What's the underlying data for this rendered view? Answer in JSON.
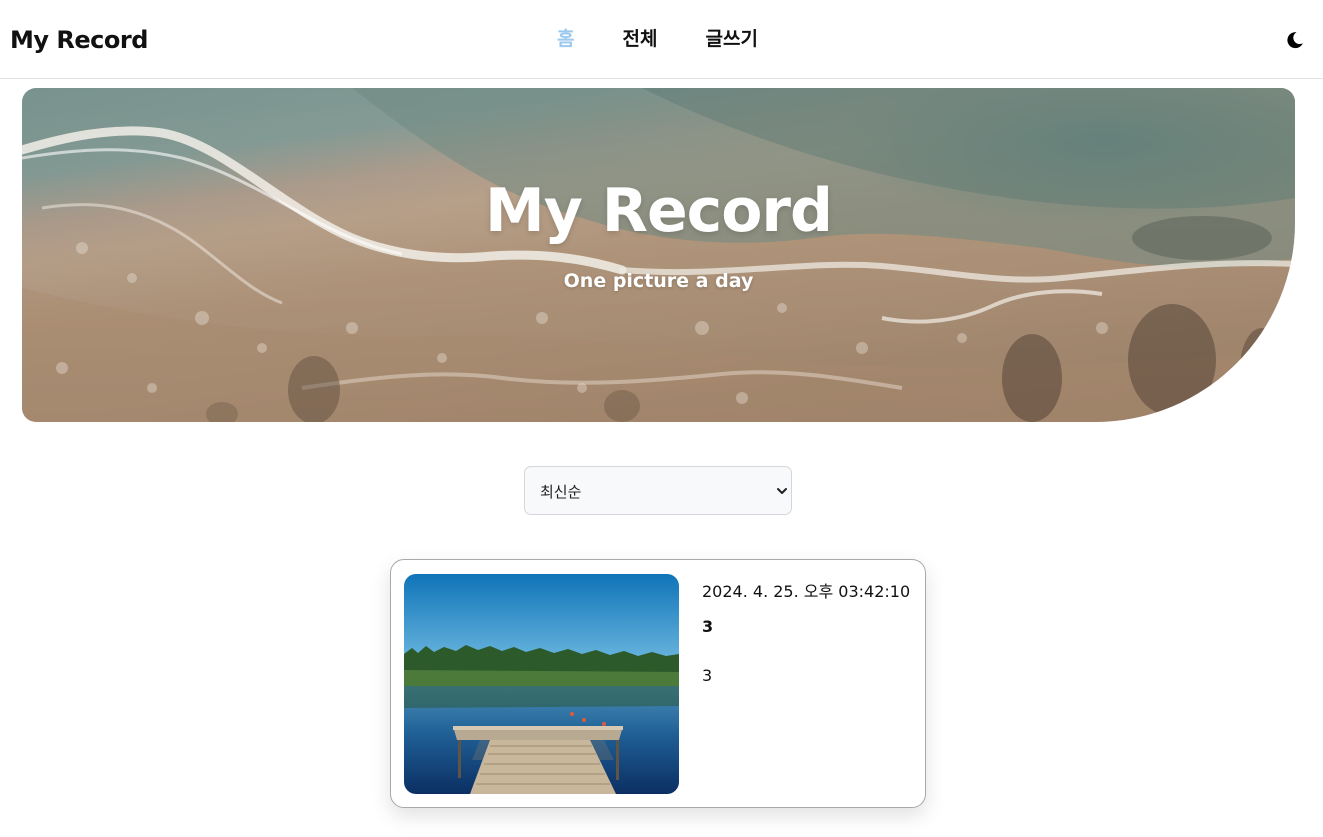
{
  "header": {
    "brand": "My Record",
    "nav": [
      {
        "label": "홈",
        "active": true
      },
      {
        "label": "전체",
        "active": false
      },
      {
        "label": "글쓰기",
        "active": false
      }
    ],
    "theme_icon": "moon-icon",
    "active_color": "#9cc9ee"
  },
  "hero": {
    "title": "My Record",
    "subtitle": "One picture a day",
    "background": "aerial-beach-waves-image"
  },
  "sort": {
    "selected": "최신순"
  },
  "posts": [
    {
      "date": "2024. 4. 25. 오후 03:42:10",
      "title": "3",
      "body": "3",
      "image": "lake-dock-photo"
    }
  ]
}
